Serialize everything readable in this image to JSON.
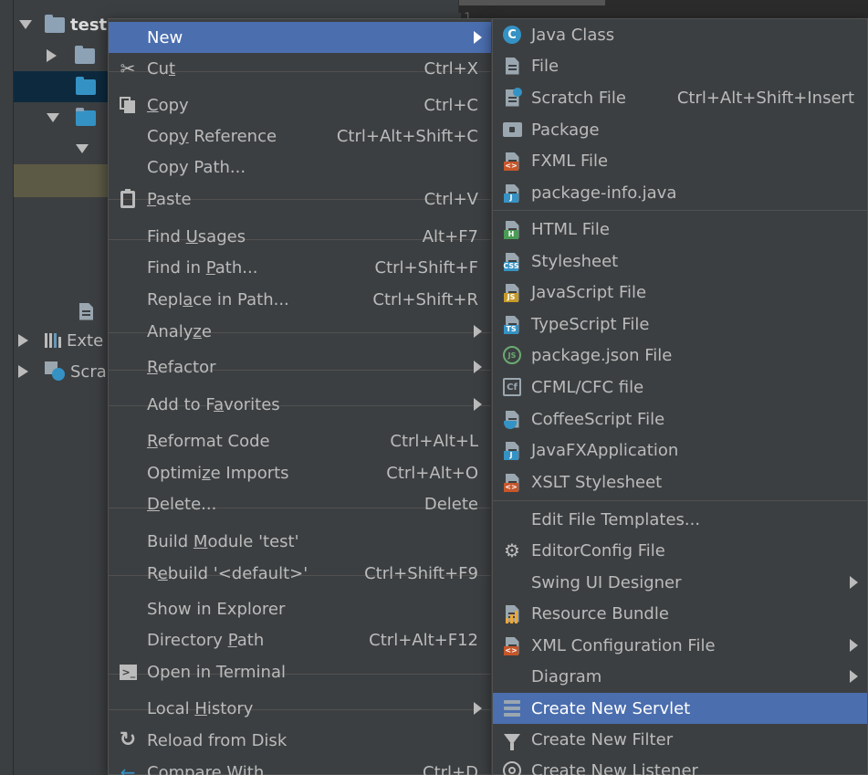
{
  "tree": {
    "project_name": "test",
    "external_libraries_label": "Exte",
    "scratches_label": "Scra"
  },
  "gutter": {
    "line": "1"
  },
  "main_menu": {
    "items": [
      {
        "label": "New",
        "shortcut": "",
        "submenu": true,
        "icon": "none",
        "mnemonic": ""
      },
      {
        "label_pre": "Cu",
        "label_u": "t",
        "label_post": "",
        "shortcut": "Ctrl+X",
        "icon": "scissors-icon"
      },
      {
        "label_pre": "",
        "label_u": "C",
        "label_post": "opy",
        "shortcut": "Ctrl+C",
        "icon": "copy-icon"
      },
      {
        "label_pre": "Cop",
        "label_u": "y",
        "label_post": " Reference",
        "shortcut": "Ctrl+Alt+Shift+C",
        "icon": "none"
      },
      {
        "label_pre": "Copy Path...",
        "label_u": "",
        "label_post": "",
        "shortcut": "",
        "icon": "none"
      },
      {
        "label_pre": "",
        "label_u": "P",
        "label_post": "aste",
        "shortcut": "Ctrl+V",
        "icon": "paste-icon"
      },
      {
        "label_pre": "Find ",
        "label_u": "U",
        "label_post": "sages",
        "shortcut": "Alt+F7",
        "icon": "none"
      },
      {
        "label_pre": "Find in ",
        "label_u": "P",
        "label_post": "ath...",
        "shortcut": "Ctrl+Shift+F",
        "icon": "none"
      },
      {
        "label_pre": "Repl",
        "label_u": "a",
        "label_post": "ce in Path...",
        "shortcut": "Ctrl+Shift+R",
        "icon": "none"
      },
      {
        "label_pre": "Analy",
        "label_u": "z",
        "label_post": "e",
        "shortcut": "",
        "submenu": true,
        "icon": "none"
      },
      {
        "label_pre": "",
        "label_u": "R",
        "label_post": "efactor",
        "shortcut": "",
        "submenu": true,
        "icon": "none"
      },
      {
        "label_pre": "Add to F",
        "label_u": "a",
        "label_post": "vorites",
        "shortcut": "",
        "submenu": true,
        "icon": "none"
      },
      {
        "label_pre": "",
        "label_u": "R",
        "label_post": "eformat Code",
        "shortcut": "Ctrl+Alt+L",
        "icon": "none"
      },
      {
        "label_pre": "Optimi",
        "label_u": "z",
        "label_post": "e Imports",
        "shortcut": "Ctrl+Alt+O",
        "icon": "none"
      },
      {
        "label_pre": "",
        "label_u": "D",
        "label_post": "elete...",
        "shortcut": "Delete",
        "icon": "none"
      },
      {
        "label_pre": "Build ",
        "label_u": "M",
        "label_post": "odule 'test'",
        "shortcut": "",
        "icon": "none"
      },
      {
        "label_pre": "R",
        "label_u": "e",
        "label_post": "build '<default>'",
        "shortcut": "Ctrl+Shift+F9",
        "icon": "none"
      },
      {
        "label_pre": "Show in Explorer",
        "label_u": "",
        "label_post": "",
        "shortcut": "",
        "icon": "none"
      },
      {
        "label_pre": "Directory ",
        "label_u": "P",
        "label_post": "ath",
        "shortcut": "Ctrl+Alt+F12",
        "icon": "none"
      },
      {
        "label_pre": "Open in Terminal",
        "label_u": "",
        "label_post": "",
        "shortcut": "",
        "icon": "terminal-icon"
      },
      {
        "label_pre": "Local ",
        "label_u": "H",
        "label_post": "istory",
        "shortcut": "",
        "submenu": true,
        "icon": "none"
      },
      {
        "label_pre": "Reload from Disk",
        "label_u": "",
        "label_post": "",
        "shortcut": "",
        "icon": "reload-icon"
      },
      {
        "label_pre": "Compare With...",
        "label_u": "",
        "label_post": "",
        "shortcut": "Ctrl+D",
        "icon": "compare-icon"
      }
    ]
  },
  "sub_menu": {
    "items": [
      {
        "label": "Java Class",
        "shortcut": "",
        "icon": "java-class-icon"
      },
      {
        "label": "File",
        "shortcut": "",
        "icon": "file-icon"
      },
      {
        "label": "Scratch File",
        "shortcut": "Ctrl+Alt+Shift+Insert",
        "icon": "scratch-file-icon"
      },
      {
        "label": "Package",
        "shortcut": "",
        "icon": "package-icon"
      },
      {
        "label": "FXML File",
        "shortcut": "",
        "icon": "fxml-file-icon"
      },
      {
        "label": "package-info.java",
        "shortcut": "",
        "icon": "package-info-icon"
      },
      {
        "label": "HTML File",
        "shortcut": "",
        "icon": "html-file-icon"
      },
      {
        "label": "Stylesheet",
        "shortcut": "",
        "icon": "css-file-icon"
      },
      {
        "label": "JavaScript File",
        "shortcut": "",
        "icon": "js-file-icon"
      },
      {
        "label": "TypeScript File",
        "shortcut": "",
        "icon": "ts-file-icon"
      },
      {
        "label": "package.json File",
        "shortcut": "",
        "icon": "nodejs-icon"
      },
      {
        "label": "CFML/CFC file",
        "shortcut": "",
        "icon": "cfml-icon"
      },
      {
        "label": "CoffeeScript File",
        "shortcut": "",
        "icon": "coffeescript-icon"
      },
      {
        "label": "JavaFXApplication",
        "shortcut": "",
        "icon": "javafx-icon"
      },
      {
        "label": "XSLT Stylesheet",
        "shortcut": "",
        "icon": "xslt-icon"
      },
      {
        "label": "Edit File Templates...",
        "shortcut": "",
        "icon": "none"
      },
      {
        "label": "EditorConfig File",
        "shortcut": "",
        "icon": "gear-icon"
      },
      {
        "label": "Swing UI Designer",
        "shortcut": "",
        "icon": "none",
        "submenu": true
      },
      {
        "label": "Resource Bundle",
        "shortcut": "",
        "icon": "resource-bundle-icon"
      },
      {
        "label": "XML Configuration File",
        "shortcut": "",
        "icon": "xml-file-icon",
        "submenu": true
      },
      {
        "label": "Diagram",
        "shortcut": "",
        "icon": "none",
        "submenu": true
      },
      {
        "label": "Create New Servlet",
        "shortcut": "",
        "icon": "servlet-icon",
        "active": true
      },
      {
        "label": "Create New Filter",
        "shortcut": "",
        "icon": "filter-icon"
      },
      {
        "label": "Create New Listener",
        "shortcut": "",
        "icon": "listener-icon"
      }
    ]
  },
  "colors": {
    "menu_bg": "#3c3f41",
    "selection": "#4b6eaf",
    "tree_selected": "#0d293e",
    "text": "#bbbbbb"
  }
}
